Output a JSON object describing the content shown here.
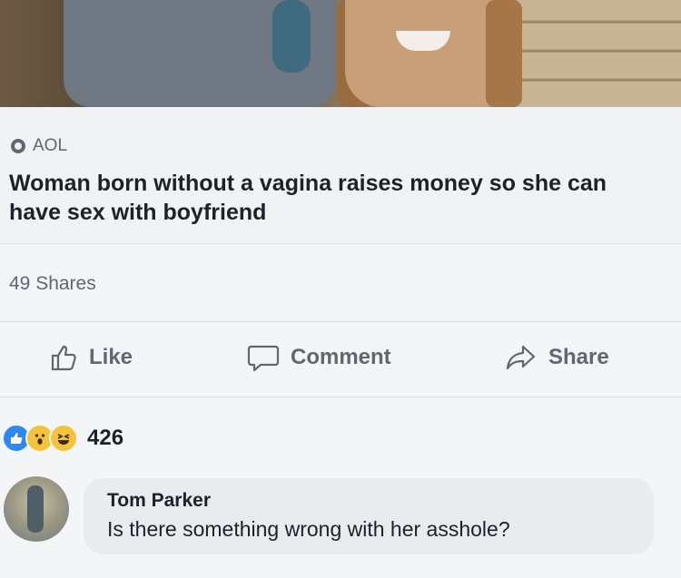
{
  "post": {
    "source": "AOL",
    "headline": "Woman born without a vagina raises money so she can have sex with boyfriend",
    "shares": "49 Shares"
  },
  "actions": {
    "like": "Like",
    "comment": "Comment",
    "share": "Share"
  },
  "reactions": {
    "count": "426",
    "types": [
      "like-icon",
      "wow-icon",
      "haha-icon"
    ]
  },
  "comment": {
    "author": "Tom Parker",
    "text": "Is there something wrong with her asshole?"
  },
  "colors": {
    "like_blue": "#2d87f5",
    "reaction_yellow": "#f5c33b",
    "muted_text": "#606770"
  }
}
